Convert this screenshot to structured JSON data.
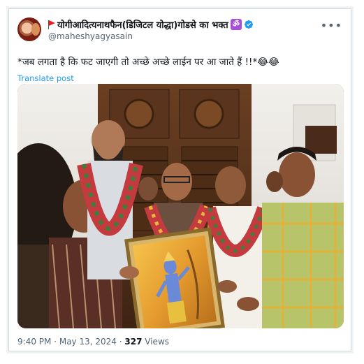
{
  "post": {
    "display_name": "योगीआदित्यनाथफैन(डिजिटल योद्धा)गोडसे का भक्त",
    "om_symbol": "ॐ",
    "handle": "@maheshyagyasain",
    "text": "*जब लगता है कि फट जाएगी तो अच्छे अच्छे लाईन पर आ जाते हैं !!*😂😂",
    "translate_label": "Translate post",
    "time": "9:40 PM",
    "separator": "·",
    "date": "May 13, 2024",
    "views_count": "327",
    "views_label": "Views"
  },
  "icons": {
    "flag": "triangular-flag-icon",
    "verified": "verified-badge-icon",
    "more": "more-options-icon"
  },
  "colors": {
    "link": "#1d9bf0",
    "secondary_text": "#536471",
    "verified": "#1d9bf0",
    "om_badge": "#a64fd9",
    "flag": "#e61e1e"
  }
}
